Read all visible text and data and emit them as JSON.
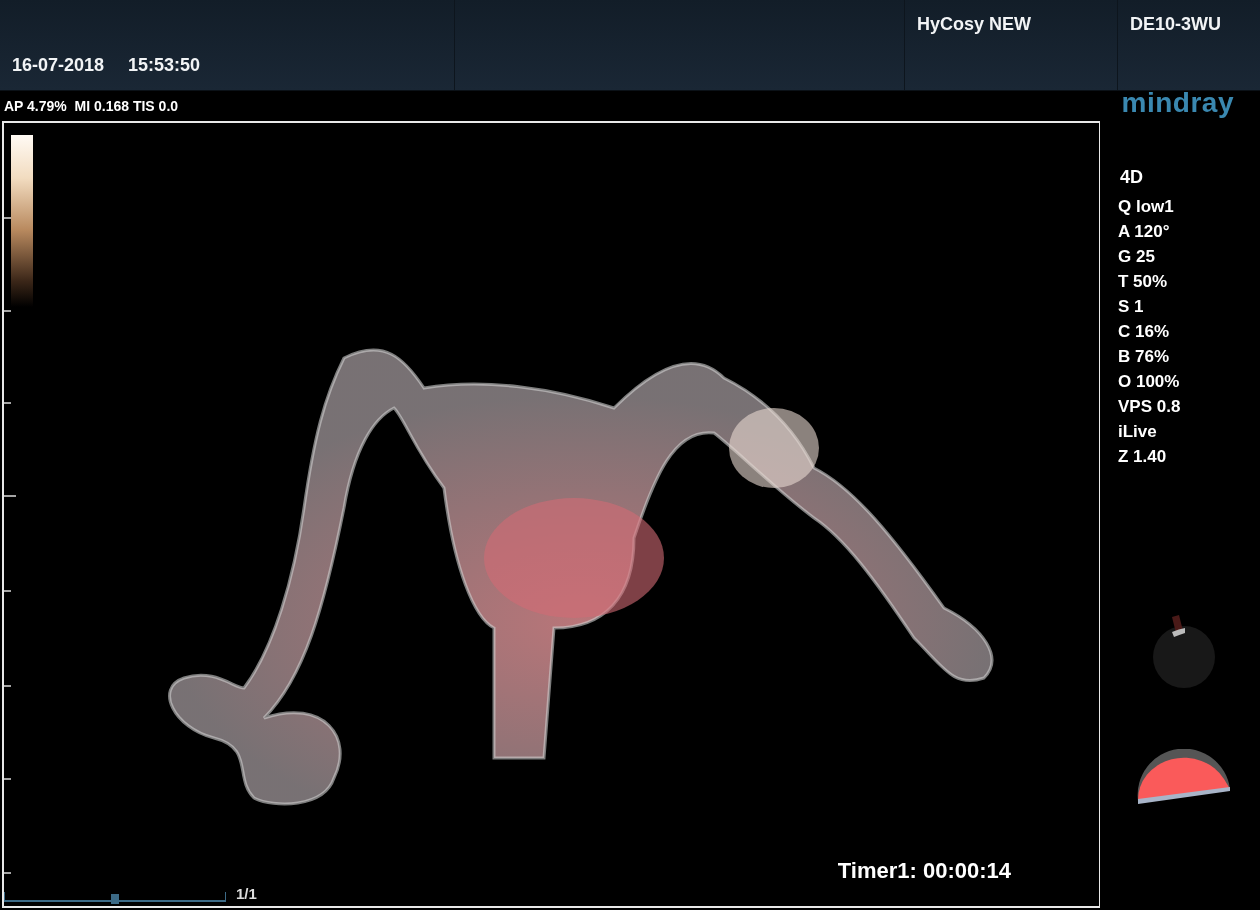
{
  "header": {
    "date": "16-07-2018",
    "time": "15:53:50",
    "exam": "HyCosy NEW",
    "probe": "DE10-3WU"
  },
  "acoustic_output": "AP 4.79%  MI 0.168 TIS 0.0",
  "logo": "mindray",
  "mode": "4D",
  "parameters": [
    "Q low1",
    "A 120°",
    "G 25",
    "T 50%",
    "S 1",
    "C 16%",
    "B 76%",
    "O 100%",
    "VPS 0.8",
    "iLive",
    "Z 1.40"
  ],
  "image": {
    "timer": "Timer1: 00:00:14",
    "cine": {
      "level": 0.5,
      "frame": "1/1"
    }
  }
}
